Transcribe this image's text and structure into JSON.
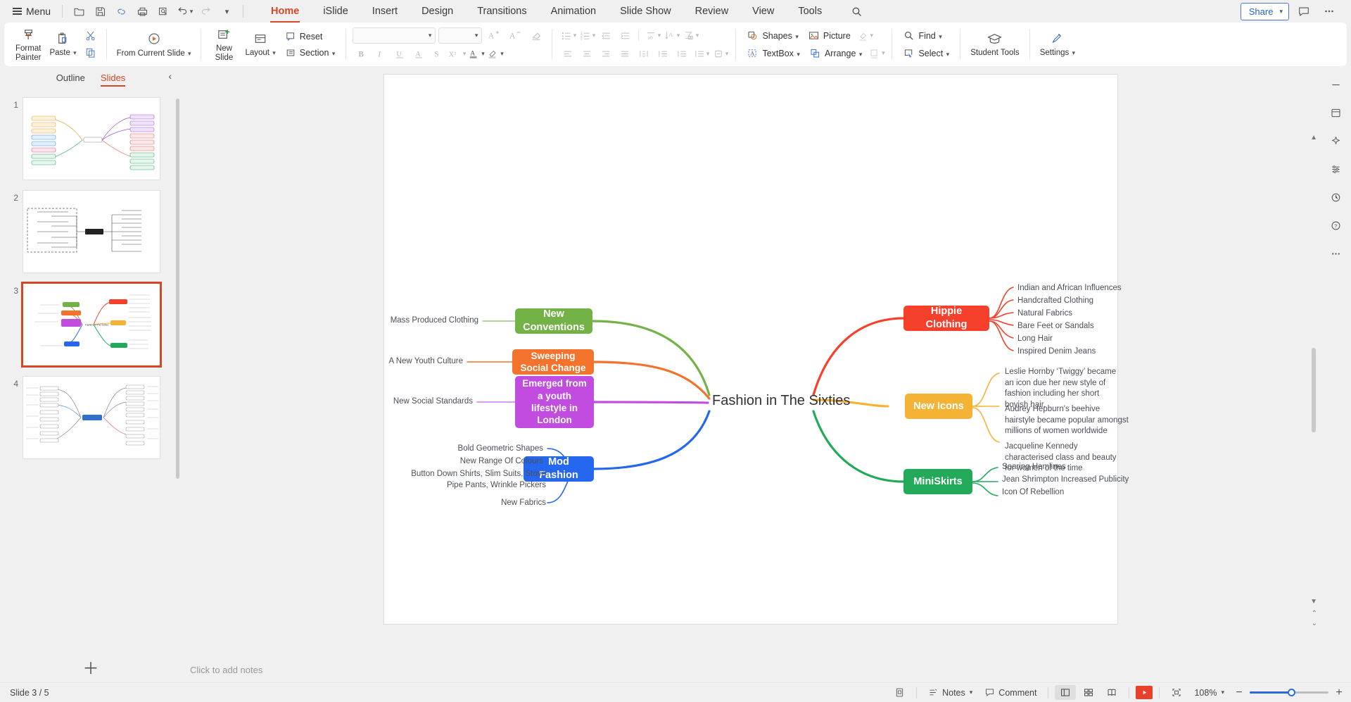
{
  "menubar": {
    "menu_label": "Menu",
    "quick_icons": [
      "folder-open-icon",
      "save-icon",
      "link-icon",
      "print-icon",
      "print-preview-icon",
      "undo-icon",
      "redo-icon",
      "more-quick-icon"
    ],
    "tabs": [
      {
        "label": "Home",
        "active": true
      },
      {
        "label": "iSlide",
        "active": false
      },
      {
        "label": "Insert",
        "active": false
      },
      {
        "label": "Design",
        "active": false
      },
      {
        "label": "Transitions",
        "active": false
      },
      {
        "label": "Animation",
        "active": false
      },
      {
        "label": "Slide Show",
        "active": false
      },
      {
        "label": "Review",
        "active": false
      },
      {
        "label": "View",
        "active": false
      },
      {
        "label": "Tools",
        "active": false
      }
    ],
    "share_label": "Share"
  },
  "ribbon": {
    "format_painter": "Format\nPainter",
    "paste": "Paste",
    "cut_icon": "scissors-icon",
    "copy_icon": "copy-icon",
    "from_current_slide": "From Current Slide",
    "new_slide": "New\nSlide",
    "layout": "Layout",
    "reset": "Reset",
    "section": "Section",
    "font_name_placeholder": "",
    "font_size_placeholder": "",
    "shapes": "Shapes",
    "picture": "Picture",
    "textbox": "TextBox",
    "arrange": "Arrange",
    "find": "Find",
    "select": "Select",
    "student_tools": "Student Tools",
    "settings": "Settings"
  },
  "sidebar": {
    "tabs": [
      {
        "label": "Outline",
        "active": false
      },
      {
        "label": "Slides",
        "active": true
      }
    ],
    "slides": [
      {
        "number": "1",
        "selected": false
      },
      {
        "number": "2",
        "selected": false
      },
      {
        "number": "3",
        "selected": true
      },
      {
        "number": "4",
        "selected": false
      }
    ],
    "add_slide_icon": "plus-icon"
  },
  "notes": {
    "placeholder": "Click to add notes"
  },
  "statusbar": {
    "slide_counter": "Slide 3 / 5",
    "notes_label": "Notes",
    "comment_label": "Comment",
    "zoom_level": "108%",
    "view_icons": [
      "normal-view-icon",
      "slide-sorter-icon",
      "reading-view-icon"
    ],
    "fit_icon": "fit-to-window-icon",
    "play_icon": "play-icon",
    "zoom_out_label": "−",
    "zoom_in_label": "+"
  },
  "rightrail": {
    "buttons": [
      "minimize-panel-icon",
      "design-ideas-icon",
      "ai-magic-icon",
      "adjust-icon",
      "history-icon",
      "help-icon",
      "more-options-icon"
    ]
  },
  "mindmap": {
    "center": "Fashion in The Sixties",
    "left_branches": [
      {
        "title": "New Conventions",
        "color": "#73b246",
        "leaves": [
          "Mass Produced Clothing"
        ]
      },
      {
        "title": "Sweeping Social Change",
        "color": "#f3722c",
        "leaves": [
          "A New Youth Culture"
        ]
      },
      {
        "title": "Emerged from a youth lifestyle in London",
        "color": "#c24ce0",
        "leaves": [
          "New Social Standards"
        ]
      },
      {
        "title": "Mod Fashion",
        "color": "#2568ef",
        "leaves": [
          "Bold Geometric Shapes",
          "New Range Of Colours",
          "Button Down Shirts, Slim Suits, Stove Pipe Pants, Wrinkle Pickers",
          "New Fabrics"
        ]
      }
    ],
    "right_branches": [
      {
        "title": "Hippie Clothing",
        "color": "#f5402c",
        "leaves": [
          "Indian and African Influences",
          "Handcrafted Clothing",
          "Natural Fabrics",
          "Bare Feet or Sandals",
          "Long Hair",
          "Inspired Denim Jeans"
        ]
      },
      {
        "title": "New Icons",
        "color": "#f5b335",
        "leaves": [
          "Leslie Hornby ‘Twiggy’ became an icon due her new style of fashion including her short boyish hair.",
          "Audrey Hepburn's beehive hairstyle became popular amongst millions of women worldwide",
          "Jacqueline Kennedy characterised class and beauty for women of the time"
        ]
      },
      {
        "title": "MiniSkirts",
        "color": "#22a95a",
        "leaves": [
          "Soaring Hemlines",
          "Jean Shrimpton Increased Publicity",
          "Icon Of Rebellion"
        ]
      }
    ]
  }
}
